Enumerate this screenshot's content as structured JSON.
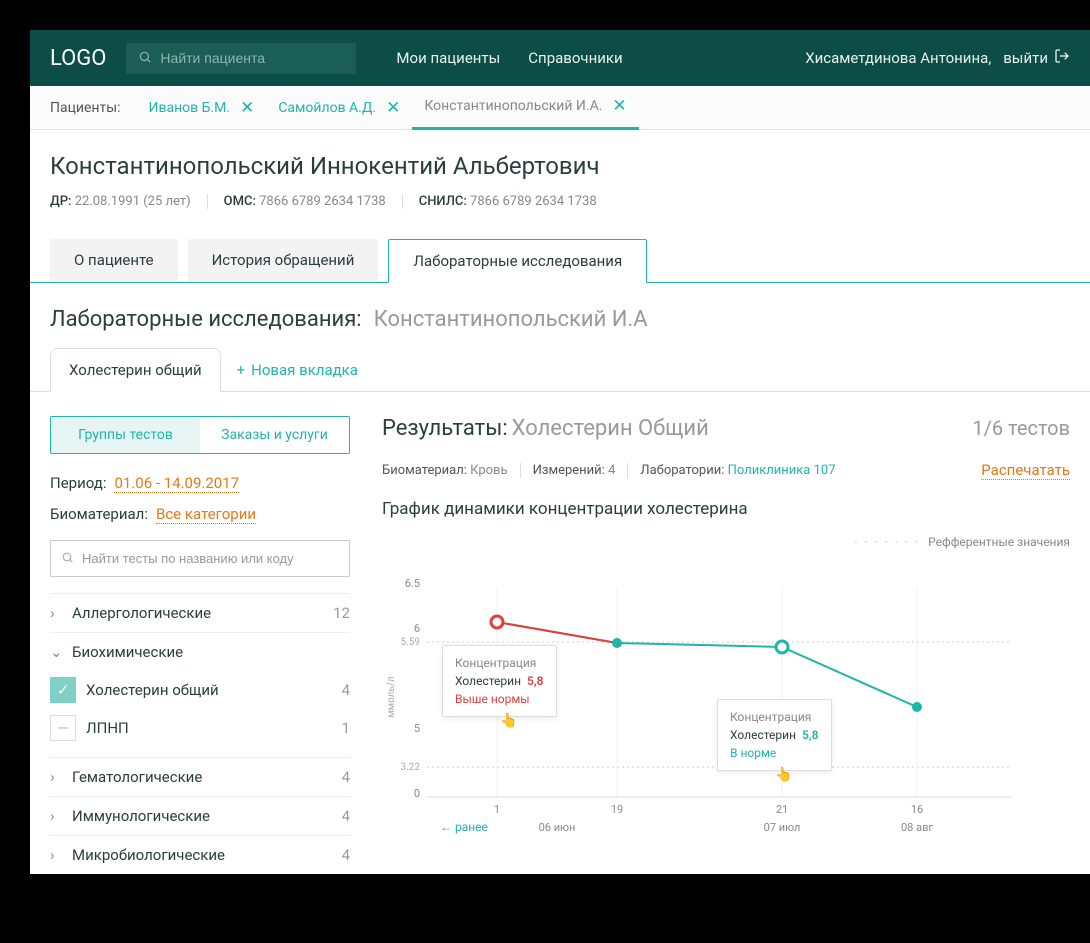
{
  "header": {
    "logo": "LOGO",
    "search_placeholder": "Найти пациента",
    "nav": [
      "Мои пациенты",
      "Справочники"
    ],
    "user_name": "Хисаметдинова Антонина,",
    "logout": "выйти"
  },
  "patient_tabs": {
    "label": "Пациенты:",
    "tabs": [
      {
        "label": "Иванов Б.М.",
        "active": false
      },
      {
        "label": "Самойлов А.Д.",
        "active": false
      },
      {
        "label": "Константинопольский И.А.",
        "active": true
      }
    ]
  },
  "patient": {
    "full_name": "Константинопольский Иннокентий Альбертович",
    "meta": [
      {
        "label": "ДР:",
        "value": "22.08.1991 (25 лет)"
      },
      {
        "label": "ОМС:",
        "value": "7866 6789 2634 1738"
      },
      {
        "label": "СНИЛС:",
        "value": "7866 6789 2634 1738"
      }
    ]
  },
  "main_tabs": [
    "О пациенте",
    "История обращений",
    "Лабораторные исследования"
  ],
  "main_tabs_active": 2,
  "section": {
    "title": "Лабораторные исследования:",
    "sub": "Константинопольский И.А"
  },
  "inner_tabs": {
    "tabs": [
      "Холестерин общий"
    ],
    "add_label": "Новая вкладка"
  },
  "sidebar": {
    "toggle": [
      "Группы тестов",
      "Заказы и услуги"
    ],
    "toggle_active": 0,
    "period_label": "Период:",
    "period_value": "01.06 - 14.09.2017",
    "biomat_label": "Биоматериал:",
    "biomat_value": "Все категории",
    "search_placeholder": "Найти тесты по названию или коду",
    "groups": [
      {
        "name": "Аллергологические",
        "count": 12,
        "open": false
      },
      {
        "name": "Биохимические",
        "count": "",
        "open": true,
        "items": [
          {
            "label": "Холестерин общий",
            "count": 4,
            "checked": true
          },
          {
            "label": "ЛПНП",
            "count": 1,
            "checked": false
          }
        ]
      },
      {
        "name": "Гематологические",
        "count": 4,
        "open": false
      },
      {
        "name": "Иммунологические",
        "count": 4,
        "open": false
      },
      {
        "name": "Микробиологические",
        "count": 4,
        "open": false
      }
    ]
  },
  "results": {
    "title": "Результаты:",
    "sub": "Холестерин Общий",
    "count_label": "1/6 тестов",
    "meta": [
      {
        "label": "Биоматериал:",
        "value": "Кровь",
        "link": false
      },
      {
        "label": "Измерений:",
        "value": "4",
        "link": false
      },
      {
        "label": "Лаборатории:",
        "value": "Поликлиника 107",
        "link": true
      }
    ],
    "print": "Распечатать",
    "chart_title": "График динамики концентрации холестерина",
    "legend": "Рефферентные значения",
    "earlier": " ранее",
    "y_axis_label": "ммоль/л"
  },
  "chart_data": {
    "type": "line",
    "x": [
      "1",
      "19",
      "21",
      "16"
    ],
    "x_months": [
      "06 июн",
      "07 июл",
      "08 авг"
    ],
    "values": [
      6.05,
      5.8,
      5.75,
      5.2
    ],
    "y_ticks": [
      0,
      5.0,
      6.0,
      6.5
    ],
    "ref_lines": [
      3.22,
      5.59
    ],
    "ylim": [
      0,
      6.8
    ]
  },
  "tooltips": {
    "t1": {
      "header": "Концентрация",
      "name": "Холестерин",
      "value": "5,8",
      "status": "Выше нормы",
      "cls": "high"
    },
    "t2": {
      "header": "Концентрация",
      "name": "Холестерин",
      "value": "5,8",
      "status": "В норме",
      "cls": "ok"
    }
  }
}
